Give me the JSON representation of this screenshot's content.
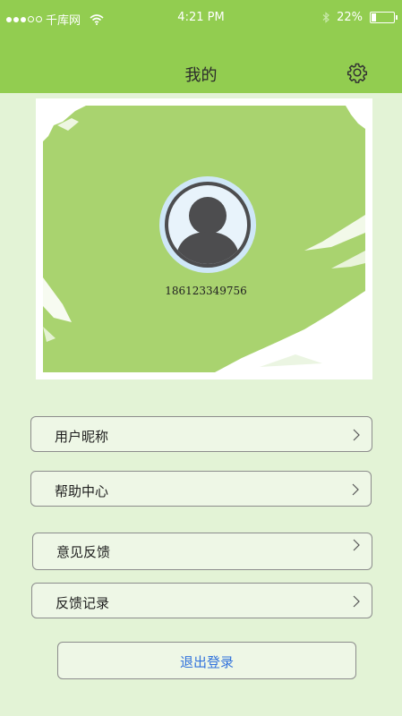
{
  "status_bar": {
    "carrier": "千库网",
    "time": "4:21 PM",
    "battery_percent": "22%",
    "battery_level": 0.22,
    "icons": [
      "signal-dots-icon",
      "wifi-icon",
      "bluetooth-icon",
      "battery-icon"
    ]
  },
  "header": {
    "title": "我的",
    "settings_icon": "gear-icon"
  },
  "profile": {
    "avatar_icon": "user-avatar-icon",
    "phone": "186123349756"
  },
  "menu": {
    "items": [
      {
        "label": "用户昵称"
      },
      {
        "label": "帮助中心"
      },
      {
        "label": "意见反馈"
      },
      {
        "label": "反馈记录"
      }
    ]
  },
  "logout": {
    "label": "退出登录"
  },
  "colors": {
    "header_bg": "#92cd50",
    "page_bg": "#e3f3d6",
    "card_paint": "#a9d36f",
    "logout_text": "#3273dc"
  }
}
